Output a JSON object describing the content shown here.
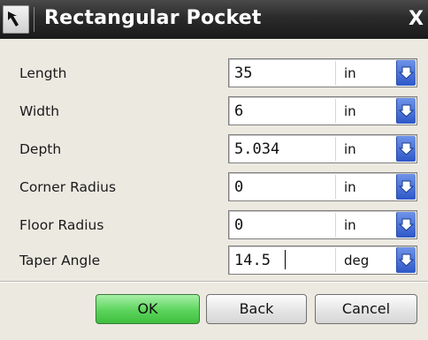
{
  "dialog": {
    "title": "Rectangular Pocket",
    "close_glyph": "X"
  },
  "fields": [
    {
      "label": "Length",
      "value": "35",
      "unit": "in"
    },
    {
      "label": "Width",
      "value": "6",
      "unit": "in"
    },
    {
      "label": "Depth",
      "value": "5.034",
      "unit": "in"
    },
    {
      "label": "Corner Radius",
      "value": "0",
      "unit": "in"
    },
    {
      "label": "Floor Radius",
      "value": "0",
      "unit": "in"
    },
    {
      "label": "Taper Angle",
      "value": "14.5",
      "unit": "deg"
    }
  ],
  "buttons": {
    "ok": "OK",
    "back": "Back",
    "cancel": "Cancel"
  },
  "colors": {
    "titlebar": "#2b2b2b",
    "dropdown_accent": "#2f58c8",
    "ok_button": "#5cd45c"
  },
  "icons": {
    "title": "arrow-cursor-icon",
    "dropdown": "chevron-down-icon",
    "close": "close-icon"
  }
}
